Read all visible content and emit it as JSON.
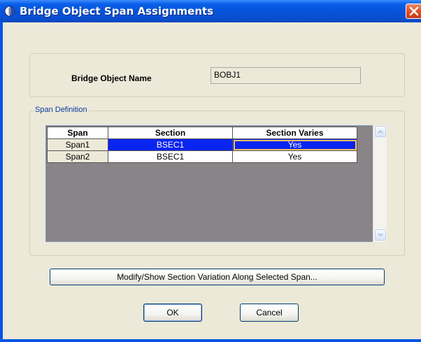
{
  "window": {
    "title": "Bridge Object Span Assignments"
  },
  "bridge_object": {
    "label": "Bridge Object Name",
    "value": "BOBJ1"
  },
  "span_definition": {
    "legend": "Span Definition",
    "columns": [
      "Span",
      "Section",
      "Section Varies"
    ],
    "rows": [
      {
        "span": "Span1",
        "section": "BSEC1",
        "varies": "Yes",
        "selected": true
      },
      {
        "span": "Span2",
        "section": "BSEC1",
        "varies": "Yes",
        "selected": false
      }
    ]
  },
  "buttons": {
    "modify": "Modify/Show Section Variation Along Selected Span...",
    "ok": "OK",
    "cancel": "Cancel"
  },
  "colors": {
    "title_bar": "#0553d8",
    "selection": "#0a24f0",
    "grid_background": "#888488",
    "dialog_background": "#ece9d8"
  }
}
